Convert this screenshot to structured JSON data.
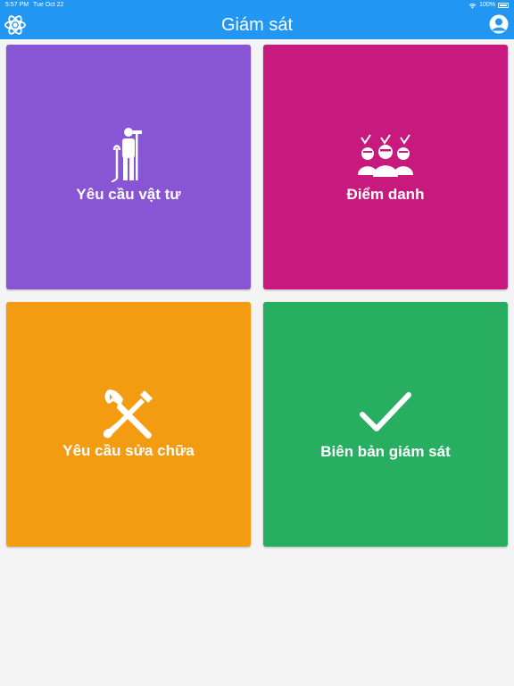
{
  "status_bar": {
    "time": "5:57 PM",
    "date": "Tue Oct 22",
    "battery": "100%"
  },
  "header": {
    "title": "Giám sát"
  },
  "tiles": [
    {
      "label": "Yêu cầu vật tư",
      "color": "#8855d4",
      "icon": "worker-with-broom-icon"
    },
    {
      "label": "Điểm danh",
      "color": "#c8197f",
      "icon": "group-attendance-icon"
    },
    {
      "label": "Yêu cầu sửa chữa",
      "color": "#f39c12",
      "icon": "wrench-screwdriver-icon"
    },
    {
      "label": "Biên bản giám sát",
      "color": "#27ae60",
      "icon": "checkmark-icon"
    }
  ]
}
